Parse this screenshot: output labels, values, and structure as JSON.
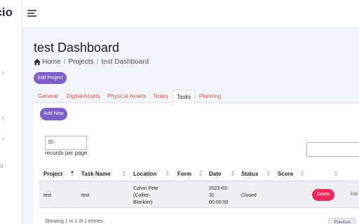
{
  "brand": {
    "text": "cio"
  },
  "header": {
    "menu_icon": "hamburger-menu-icon"
  },
  "page": {
    "title": "test Dashboard"
  },
  "breadcrumb": {
    "home_icon": "home-icon",
    "items": [
      "Home",
      "Projects",
      "test Dashboard"
    ],
    "separator": "/"
  },
  "actions": {
    "edit_project": "Edit Project",
    "add_new": "Add New"
  },
  "tabs": [
    {
      "label": "General",
      "active": false
    },
    {
      "label": "Digital Assets",
      "active": false
    },
    {
      "label": "Physical Assets",
      "active": false
    },
    {
      "label": "Notes",
      "active": false
    },
    {
      "label": "Tasks",
      "active": true
    },
    {
      "label": "Planning",
      "active": false
    }
  ],
  "table_controls": {
    "records_value": "10",
    "records_label": "records per page",
    "search_value": ""
  },
  "table": {
    "columns": [
      "Project",
      "Task Name",
      "Location",
      "Form",
      "Date",
      "Status",
      "Score"
    ],
    "rows": [
      {
        "project": "test",
        "task_name": "test",
        "location": [
          "Calvin Pete",
          "(Collier-",
          "Blockler)"
        ],
        "form": "",
        "date": [
          "2023-03-",
          "31",
          "00:00:00"
        ],
        "status": "Closed",
        "score": "",
        "delete_label": "Delete",
        "edit_label": "Edit"
      }
    ]
  },
  "footer": {
    "info": "Showing 1 to 1 of 1 entries",
    "previous": "Previous"
  },
  "colors": {
    "accent": "#7e5ec7",
    "tab_link": "#e0533f",
    "danger": "#ef2a5a",
    "background": "#f4f5fa"
  }
}
